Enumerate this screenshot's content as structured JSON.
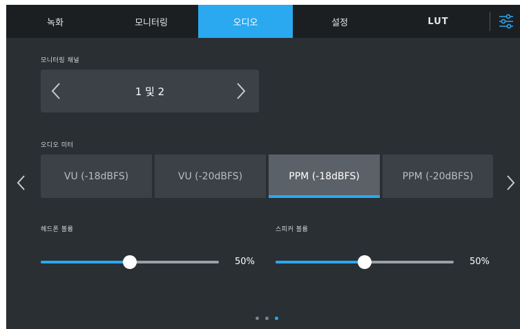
{
  "tabs": [
    {
      "label": "녹화"
    },
    {
      "label": "모니터링"
    },
    {
      "label": "오디오"
    },
    {
      "label": "설정"
    },
    {
      "label": "LUT"
    }
  ],
  "active_tab": "오디오",
  "settings_icon": "sliders-icon",
  "monitor_channel": {
    "label": "모니터링 채널",
    "value": "1 및 2"
  },
  "audio_meter": {
    "label": "오디오 미터",
    "options": [
      {
        "label": "VU (-18dBFS)"
      },
      {
        "label": "VU (-20dBFS)"
      },
      {
        "label": "PPM (-18dBFS)"
      },
      {
        "label": "PPM (-20dBFS)"
      }
    ],
    "selected": "PPM (-18dBFS)"
  },
  "headphone_volume": {
    "label": "헤드폰 볼륨",
    "value_text": "50%",
    "level": 0.5
  },
  "speaker_volume": {
    "label": "스피커 볼륨",
    "value_text": "50%",
    "level": 0.5
  },
  "page_indicator": {
    "total": 3,
    "current": 3
  },
  "colors": {
    "accent": "#2aa9f0",
    "background": "#2a2f34",
    "tabbar": "#1c1f22",
    "button": "#3b4147",
    "button_active": "#5a6168"
  }
}
